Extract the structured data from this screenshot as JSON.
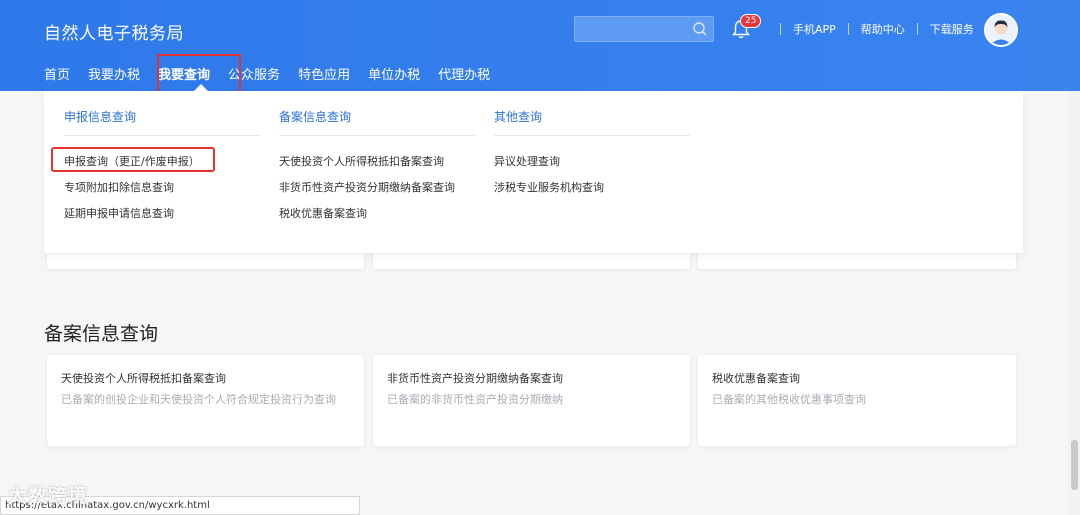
{
  "header": {
    "site_title": "自然人电子税务局",
    "search_placeholder": "",
    "notification_count": "25",
    "links": [
      "手机APP",
      "帮助中心",
      "下载服务"
    ]
  },
  "nav": {
    "items": [
      "首页",
      "我要办税",
      "我要查询",
      "公众服务",
      "特色应用",
      "单位办税",
      "代理办税"
    ],
    "active": "我要查询"
  },
  "dropdown": {
    "columns": [
      {
        "heading": "申报信息查询",
        "items": [
          "申报查询（更正/作废申报）",
          "专项附加扣除信息查询",
          "延期申报申请信息查询"
        ]
      },
      {
        "heading": "备案信息查询",
        "items": [
          "天使投资个人所得税抵扣备案查询",
          "非货币性资产投资分期缴纳备案查询",
          "税收优惠备案查询"
        ]
      },
      {
        "heading": "其他查询",
        "items": [
          "异议处理查询",
          "涉税专业服务机构查询"
        ]
      }
    ]
  },
  "section": {
    "title": "备案信息查询",
    "cards": [
      {
        "title": "天使投资个人所得税抵扣备案查询",
        "desc": "已备案的创投企业和天使投资个人符合规定投资行为查询"
      },
      {
        "title": "非货币性资产投资分期缴纳备案查询",
        "desc": "已备案的非货币性资产投资分期缴纳"
      },
      {
        "title": "税收优惠备案查询",
        "desc": "已备案的其他税收优惠事项查询"
      }
    ]
  },
  "status_url": "https://etax.chinatax.gov.cn/wycxrk.html",
  "watermark": "大数跨境",
  "colors": {
    "header_blue": "#2e79ea",
    "highlight_red": "#e0342d",
    "link_blue": "#2c72d7"
  }
}
